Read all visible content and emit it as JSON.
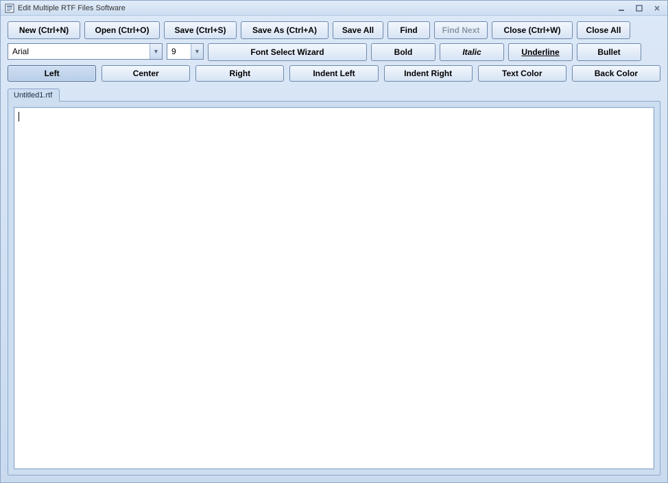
{
  "window": {
    "title": "Edit Multiple RTF Files Software"
  },
  "toolbar": {
    "row1": {
      "new": "New (Ctrl+N)",
      "open": "Open (Ctrl+O)",
      "save": "Save (Ctrl+S)",
      "save_as": "Save As (Ctrl+A)",
      "save_all": "Save All",
      "find": "Find",
      "find_next": "Find Next",
      "close": "Close (Ctrl+W)",
      "close_all": "Close All"
    },
    "row2": {
      "font_name": "Arial",
      "font_size": "9",
      "wizard": "Font Select Wizard",
      "bold": "Bold",
      "italic": "Italic",
      "underline": "Underline",
      "bullet": "Bullet"
    },
    "row3": {
      "left": "Left",
      "center": "Center",
      "right": "Right",
      "indent_left": "Indent Left",
      "indent_right": "Indent Right",
      "text_color": "Text Color",
      "back_color": "Back Color"
    }
  },
  "tabs": [
    {
      "label": "Untitled1.rtf"
    }
  ],
  "state": {
    "find_next_enabled": false,
    "active_align": "left"
  }
}
